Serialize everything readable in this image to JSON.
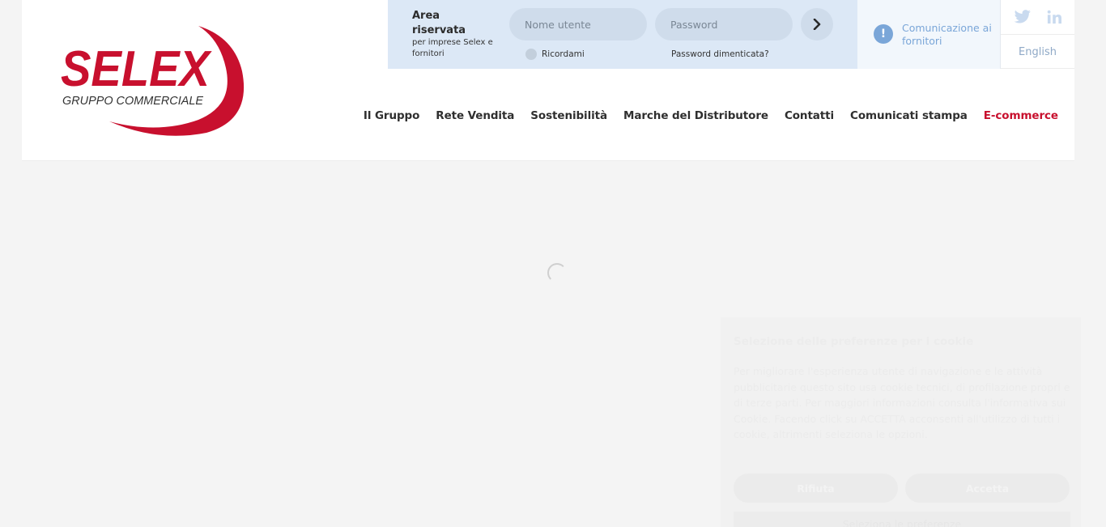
{
  "logo": {
    "brand": "SELEX",
    "tagline": "GRUPPO COMMERCIALE",
    "color": "#c8102e"
  },
  "login": {
    "title": "Area riservata",
    "subtitle": "per imprese Selex e fornitori",
    "username_placeholder": "Nome utente",
    "password_placeholder": "Password",
    "submit_icon": "chevron-right-icon",
    "remember_label": "Ricordami",
    "forgot_label": "Password dimenticata?"
  },
  "communication": {
    "label": "Comunicazione ai fornitori",
    "icon": "exclamation-icon",
    "color": "#7aa6d8"
  },
  "social": {
    "icons": [
      "twitter-icon",
      "linkedin-icon"
    ]
  },
  "language": {
    "label": "English"
  },
  "nav": {
    "items": [
      {
        "label": "Il Gruppo"
      },
      {
        "label": "Rete Vendita"
      },
      {
        "label": "Sostenibilità"
      },
      {
        "label": "Marche del Distributore"
      },
      {
        "label": "Contatti"
      },
      {
        "label": "Comunicati stampa"
      },
      {
        "label": "E-commerce"
      }
    ]
  },
  "cookie": {
    "title": "Selezione delle preferenze per i cookie",
    "text": "Per migliorare l'esperienza utente di navigazione e le attività pubblicitarie questo sito usa cookie tecnici, di profilazione propri e di terze parti. Per maggiori informazioni consulta l'informativa sui Cookie. Facendo click su ACCETTA acconsenti all'utilizzo di tutti i cookie, altrimenti seleziona le opzioni.",
    "reject_label": "Rifiuta",
    "accept_label": "Accetta",
    "customize_label": "Seleziona le preferenze"
  }
}
